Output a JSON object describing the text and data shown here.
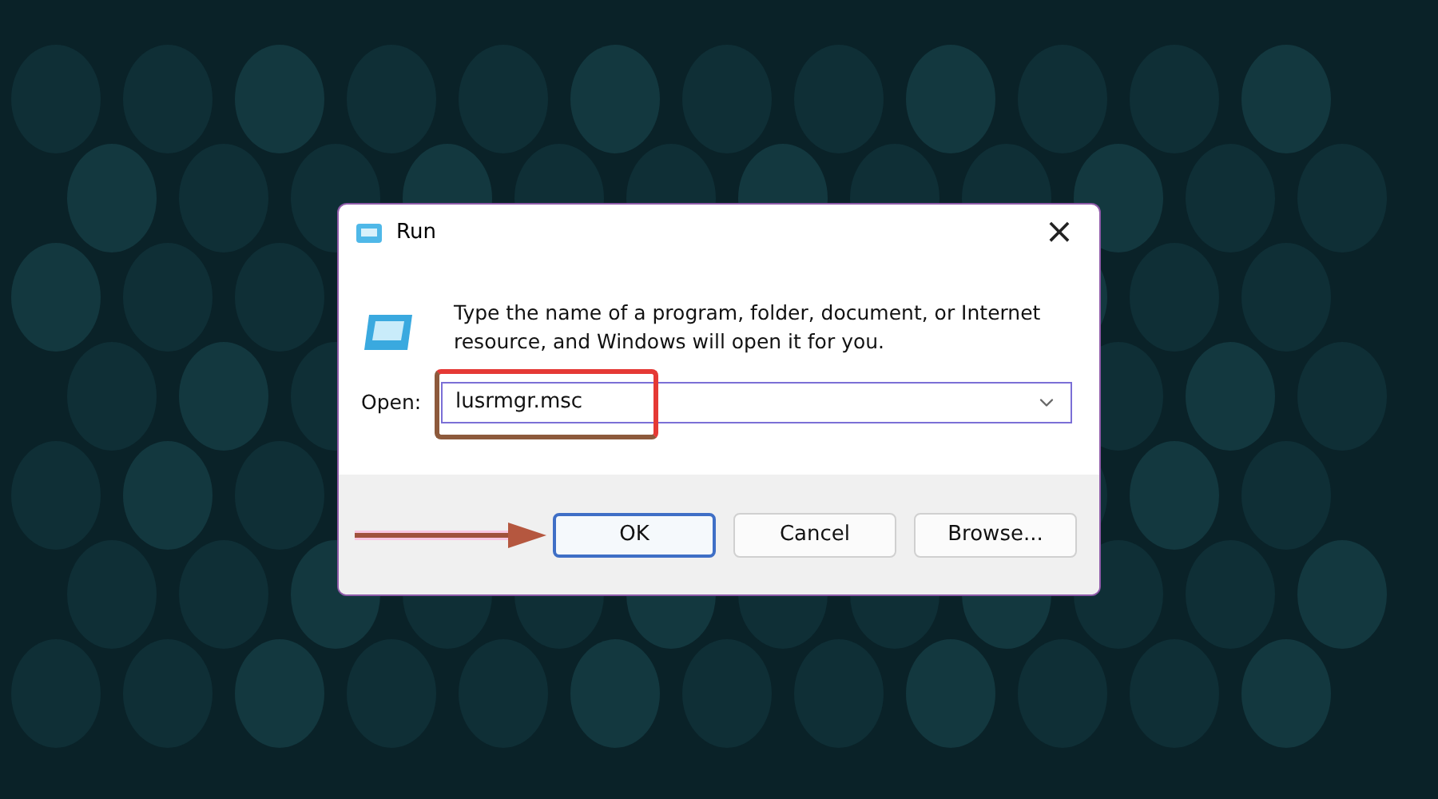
{
  "window": {
    "title": "Run",
    "close": "×"
  },
  "message": "Type the name of a program, folder, document, or Internet resource, and Windows will open it for you.",
  "open_field": {
    "label": "Open:",
    "value": "lusrmgr.msc",
    "highlighted": true
  },
  "buttons": [
    {
      "label": "OK",
      "selected": true,
      "arrow_pointing": true
    },
    {
      "label": "Cancel",
      "selected": false,
      "arrow_pointing": false
    },
    {
      "label": "Browse...",
      "selected": false,
      "arrow_pointing": false
    }
  ]
}
